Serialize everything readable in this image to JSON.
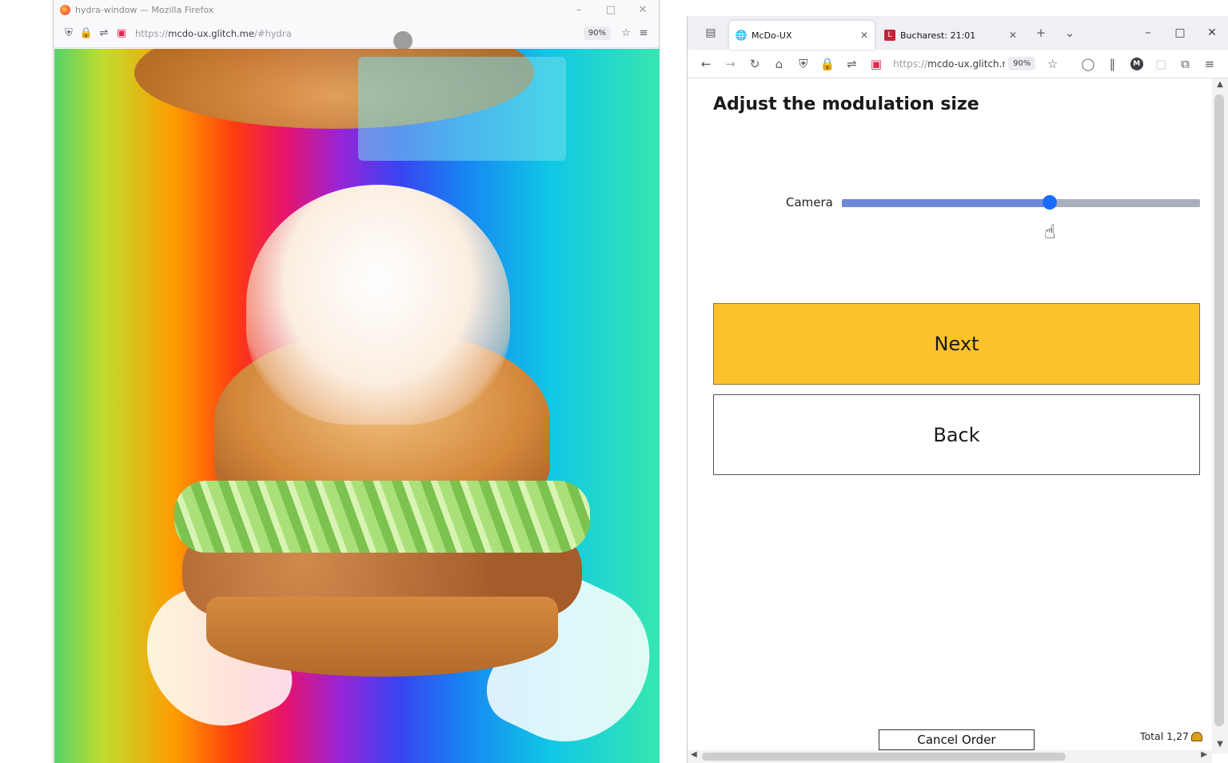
{
  "left_window": {
    "title": "hydra-window — Mozilla Firefox",
    "url_prefix": "https://",
    "url_host": "mcdo-ux.glitch.me",
    "url_rest": "/#hydra",
    "zoom": "90%"
  },
  "right_window": {
    "tabs": [
      {
        "label": "McDo-UX",
        "icon": "globe-icon",
        "active": true
      },
      {
        "label": "Bucharest: 21:01",
        "icon": "calendar-icon",
        "active": false
      }
    ],
    "url_prefix": "https://",
    "url_host": "mcdo-ux.glitch.me",
    "zoom": "90%",
    "account_initial": "M"
  },
  "page": {
    "title": "Adjust the modulation size",
    "slider": {
      "label": "Camera",
      "value_fraction": 0.58
    },
    "next_label": "Next",
    "back_label": "Back",
    "cancel_label": "Cancel Order",
    "total_label": "Total 1,27"
  },
  "colors": {
    "next_button": "#fcc22b",
    "slider_thumb": "#1c6bff"
  }
}
